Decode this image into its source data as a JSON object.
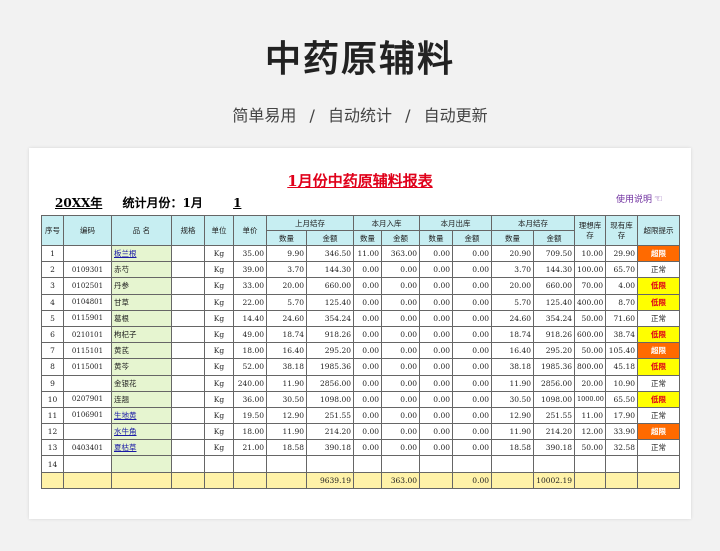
{
  "hero": {
    "title": "中药原辅料",
    "features": [
      "简单易用",
      "自动统计",
      "自动更新"
    ],
    "separator": "/"
  },
  "report": {
    "title": "1月份中药原辅料报表",
    "year": "20XX年",
    "month_label": "统计月份：1月",
    "month_number": "1",
    "help_text": "使用说明",
    "help_icon": "pointing-hand-icon"
  },
  "table": {
    "group_headers": {
      "seq": "序号",
      "code": "编码",
      "name": "品 名",
      "spec": "规格",
      "unit": "单位",
      "price": "单价",
      "prev": "上月结存",
      "in": "本月入库",
      "out": "本月出库",
      "bal": "本月结存",
      "ideal": "理想库存",
      "current": "现有库存",
      "alert": "超限提示"
    },
    "sub_headers": {
      "qty": "数量",
      "amt": "金额"
    },
    "rows": [
      {
        "seq": "1",
        "code": "",
        "name": "板兰根",
        "link": true,
        "spec": "",
        "unit": "Kg",
        "price": "35.00",
        "pq": "9.90",
        "pa": "346.50",
        "iq": "11.00",
        "ia": "363.00",
        "oq": "0.00",
        "oa": "0.00",
        "bq": "20.90",
        "ba": "709.50",
        "ideal": "10.00",
        "current": "29.90",
        "alert": "超限",
        "level": "hi"
      },
      {
        "seq": "2",
        "code": "0109301",
        "name": "赤芍",
        "link": false,
        "spec": "",
        "unit": "Kg",
        "price": "39.00",
        "pq": "3.70",
        "pa": "144.30",
        "iq": "0.00",
        "ia": "0.00",
        "oq": "0.00",
        "oa": "0.00",
        "bq": "3.70",
        "ba": "144.30",
        "ideal": "100.00",
        "current": "65.70",
        "alert": "正常",
        "level": "ok"
      },
      {
        "seq": "3",
        "code": "0102501",
        "name": "丹参",
        "link": false,
        "spec": "",
        "unit": "Kg",
        "price": "33.00",
        "pq": "20.00",
        "pa": "660.00",
        "iq": "0.00",
        "ia": "0.00",
        "oq": "0.00",
        "oa": "0.00",
        "bq": "20.00",
        "ba": "660.00",
        "ideal": "70.00",
        "current": "4.00",
        "alert": "低限",
        "level": "lo"
      },
      {
        "seq": "4",
        "code": "0104801",
        "name": "甘草",
        "link": false,
        "spec": "",
        "unit": "Kg",
        "price": "22.00",
        "pq": "5.70",
        "pa": "125.40",
        "iq": "0.00",
        "ia": "0.00",
        "oq": "0.00",
        "oa": "0.00",
        "bq": "5.70",
        "ba": "125.40",
        "ideal": "400.00",
        "current": "8.70",
        "alert": "低限",
        "level": "lo"
      },
      {
        "seq": "5",
        "code": "0115901",
        "name": "葛根",
        "link": false,
        "spec": "",
        "unit": "Kg",
        "price": "14.40",
        "pq": "24.60",
        "pa": "354.24",
        "iq": "0.00",
        "ia": "0.00",
        "oq": "0.00",
        "oa": "0.00",
        "bq": "24.60",
        "ba": "354.24",
        "ideal": "50.00",
        "current": "71.60",
        "alert": "正常",
        "level": "ok"
      },
      {
        "seq": "6",
        "code": "0210101",
        "name": "枸杞子",
        "link": false,
        "spec": "",
        "unit": "Kg",
        "price": "49.00",
        "pq": "18.74",
        "pa": "918.26",
        "iq": "0.00",
        "ia": "0.00",
        "oq": "0.00",
        "oa": "0.00",
        "bq": "18.74",
        "ba": "918.26",
        "ideal": "600.00",
        "current": "38.74",
        "alert": "低限",
        "level": "lo"
      },
      {
        "seq": "7",
        "code": "0115101",
        "name": "黄芪",
        "link": false,
        "spec": "",
        "unit": "Kg",
        "price": "18.00",
        "pq": "16.40",
        "pa": "295.20",
        "iq": "0.00",
        "ia": "0.00",
        "oq": "0.00",
        "oa": "0.00",
        "bq": "16.40",
        "ba": "295.20",
        "ideal": "50.00",
        "current": "105.40",
        "alert": "超限",
        "level": "hi"
      },
      {
        "seq": "8",
        "code": "0115001",
        "name": "黄芩",
        "link": false,
        "spec": "",
        "unit": "Kg",
        "price": "52.00",
        "pq": "38.18",
        "pa": "1985.36",
        "iq": "0.00",
        "ia": "0.00",
        "oq": "0.00",
        "oa": "0.00",
        "bq": "38.18",
        "ba": "1985.36",
        "ideal": "800.00",
        "current": "45.18",
        "alert": "低限",
        "level": "lo"
      },
      {
        "seq": "9",
        "code": "",
        "name": "金银花",
        "link": false,
        "spec": "",
        "unit": "Kg",
        "price": "240.00",
        "pq": "11.90",
        "pa": "2856.00",
        "iq": "0.00",
        "ia": "0.00",
        "oq": "0.00",
        "oa": "0.00",
        "bq": "11.90",
        "ba": "2856.00",
        "ideal": "20.00",
        "current": "10.90",
        "alert": "正常",
        "level": "ok"
      },
      {
        "seq": "10",
        "code": "0207901",
        "name": "连翘",
        "link": false,
        "spec": "",
        "unit": "Kg",
        "price": "36.00",
        "pq": "30.50",
        "pa": "1098.00",
        "iq": "0.00",
        "ia": "0.00",
        "oq": "0.00",
        "oa": "0.00",
        "bq": "30.50",
        "ba": "1098.00",
        "ideal": "1000.00",
        "current": "65.50",
        "alert": "低限",
        "level": "lo"
      },
      {
        "seq": "11",
        "code": "0106901",
        "name": "生地黄",
        "link": true,
        "spec": "",
        "unit": "Kg",
        "price": "19.50",
        "pq": "12.90",
        "pa": "251.55",
        "iq": "0.00",
        "ia": "0.00",
        "oq": "0.00",
        "oa": "0.00",
        "bq": "12.90",
        "ba": "251.55",
        "ideal": "11.00",
        "current": "17.90",
        "alert": "正常",
        "level": "ok"
      },
      {
        "seq": "12",
        "code": "",
        "name": "水牛角",
        "link": true,
        "spec": "",
        "unit": "Kg",
        "price": "18.00",
        "pq": "11.90",
        "pa": "214.20",
        "iq": "0.00",
        "ia": "0.00",
        "oq": "0.00",
        "oa": "0.00",
        "bq": "11.90",
        "ba": "214.20",
        "ideal": "12.00",
        "current": "33.90",
        "alert": "超限",
        "level": "hi"
      },
      {
        "seq": "13",
        "code": "0403401",
        "name": "夏枯草",
        "link": true,
        "spec": "",
        "unit": "Kg",
        "price": "21.00",
        "pq": "18.58",
        "pa": "390.18",
        "iq": "0.00",
        "ia": "0.00",
        "oq": "0.00",
        "oa": "0.00",
        "bq": "18.58",
        "ba": "390.18",
        "ideal": "50.00",
        "current": "32.58",
        "alert": "正常",
        "level": "ok"
      },
      {
        "seq": "14",
        "code": "",
        "name": "",
        "link": false,
        "spec": "",
        "unit": "",
        "price": "",
        "pq": "",
        "pa": "",
        "iq": "",
        "ia": "",
        "oq": "",
        "oa": "",
        "bq": "",
        "ba": "",
        "ideal": "",
        "current": "",
        "alert": "",
        "level": "none"
      }
    ],
    "totals": {
      "pa": "9639.19",
      "ia": "363.00",
      "oa": "0.00",
      "ba": "10002.19"
    }
  },
  "colors": {
    "header_bg": "#c7eef2",
    "name_bg": "#e6f5d0",
    "total_bg": "#fff2a8",
    "low_bg": "#ffff00",
    "high_bg": "#ff6a00",
    "title_red": "#e0001a"
  }
}
